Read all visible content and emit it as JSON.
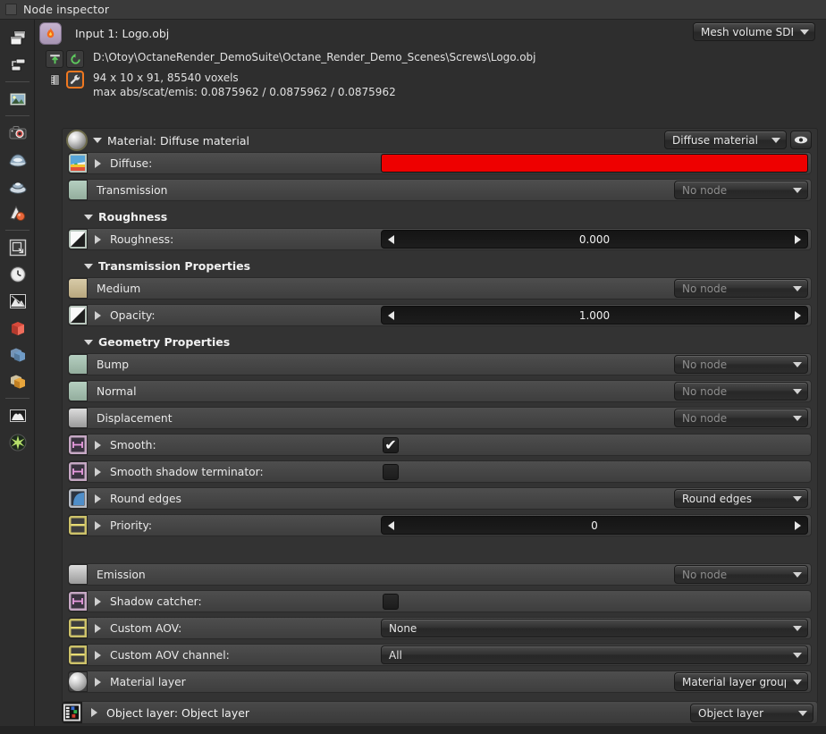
{
  "window": {
    "title": "Node inspector"
  },
  "left_toolbar": {
    "items": [
      {
        "name": "render-targets-icon",
        "label": "Render targets"
      },
      {
        "name": "node-graph-icon",
        "label": "Node graph"
      },
      {
        "sep": true
      },
      {
        "name": "image-icon",
        "label": "Image"
      },
      {
        "sep": true
      },
      {
        "name": "camera-icon",
        "label": "Camera"
      },
      {
        "name": "environment-icon",
        "label": "Environment"
      },
      {
        "name": "medium-icon",
        "label": "Medium"
      },
      {
        "name": "material-icon",
        "label": "Material"
      },
      {
        "sep": true
      },
      {
        "name": "resolution-icon",
        "label": "Resolution"
      },
      {
        "name": "clock-icon",
        "label": "Animation"
      },
      {
        "name": "render-passes-icon",
        "label": "Render passes"
      },
      {
        "name": "red-cube-icon",
        "label": "Geometry red"
      },
      {
        "name": "blue-cube-icon",
        "label": "Geometry blue"
      },
      {
        "name": "orange-cube-icon",
        "label": "Geometry orange"
      },
      {
        "sep": true
      },
      {
        "name": "histogram-icon",
        "label": "Histogram"
      },
      {
        "name": "kernel-icon",
        "label": "Kernel"
      }
    ]
  },
  "node": {
    "badge_icon": "flame-icon",
    "title": "Input 1: Logo.obj",
    "type_selector": "Mesh volume SDF",
    "file": {
      "reload_icon": "import-icon",
      "refresh_icon": "refresh-icon",
      "path": "D:\\Otoy\\OctaneRender_DemoSuite\\Octane_Render_Demo_Scenes\\Screws\\Logo.obj",
      "film_icon": "film-icon",
      "wrench_icon": "wrench-icon",
      "voxel_info": "94 x 10 x 91, 85540 voxels",
      "absorption_info": "max abs/scat/emis: 0.0875962 / 0.0875962 / 0.0875962"
    }
  },
  "material": {
    "header_label": "Material: Diffuse material",
    "header_selector": "Diffuse material",
    "eye_icon": "eye-icon",
    "rows": [
      {
        "kind": "pin",
        "name": "diffuse",
        "label": "Diffuse:",
        "pin": "image-swatch",
        "expand": true,
        "control": "color",
        "color": "#ee0000"
      },
      {
        "kind": "pin",
        "name": "transmission",
        "label": "Transmission",
        "pin": "green-swatch",
        "expand": false,
        "control": "combo",
        "value": "No node",
        "muted": true
      },
      {
        "kind": "group",
        "name": "roughness-group",
        "label": "Roughness"
      },
      {
        "kind": "pin",
        "name": "roughness",
        "label": "Roughness:",
        "pin": "gray-swatch",
        "expand": true,
        "control": "number",
        "value": "0.000"
      },
      {
        "kind": "group",
        "name": "transmission-properties-group",
        "label": "Transmission Properties"
      },
      {
        "kind": "pin",
        "name": "medium",
        "label": "Medium",
        "pin": "tan-swatch",
        "expand": false,
        "control": "combo",
        "value": "No node",
        "muted": true
      },
      {
        "kind": "pin",
        "name": "opacity",
        "label": "Opacity:",
        "pin": "gray-swatch",
        "expand": true,
        "control": "number",
        "value": "1.000"
      },
      {
        "kind": "group",
        "name": "geometry-properties-group",
        "label": "Geometry Properties"
      },
      {
        "kind": "pin",
        "name": "bump",
        "label": "Bump",
        "pin": "green-swatch",
        "expand": false,
        "control": "combo",
        "value": "No node",
        "muted": true
      },
      {
        "kind": "pin",
        "name": "normal",
        "label": "Normal",
        "pin": "green-swatch",
        "expand": false,
        "control": "combo",
        "value": "No node",
        "muted": true
      },
      {
        "kind": "pin",
        "name": "displacement",
        "label": "Displacement",
        "pin": "silver-swatch",
        "expand": false,
        "control": "combo",
        "value": "No node",
        "muted": true
      },
      {
        "kind": "pin",
        "name": "smooth",
        "label": "Smooth:",
        "pin": "bool-swatch",
        "expand": true,
        "control": "checkbox",
        "checked": true
      },
      {
        "kind": "pin",
        "name": "smooth-shadow-terminator",
        "label": "Smooth shadow terminator:",
        "pin": "bool-swatch",
        "expand": true,
        "control": "checkbox",
        "checked": false
      },
      {
        "kind": "pin",
        "name": "round-edges",
        "label": "Round edges",
        "pin": "roundedge-swatch",
        "expand": true,
        "control": "combo",
        "value": "Round edges",
        "muted": false
      },
      {
        "kind": "pin",
        "name": "priority",
        "label": "Priority:",
        "pin": "int-swatch",
        "expand": true,
        "control": "number",
        "value": "0"
      },
      {
        "kind": "spacer",
        "name": "row-spacer"
      },
      {
        "kind": "pin",
        "name": "emission",
        "label": "Emission",
        "pin": "silver-swatch",
        "expand": false,
        "control": "combo",
        "value": "No node",
        "muted": true
      },
      {
        "kind": "pin",
        "name": "shadow-catcher",
        "label": "Shadow catcher:",
        "pin": "bool-swatch",
        "expand": true,
        "control": "checkbox",
        "checked": false
      },
      {
        "kind": "pin",
        "name": "custom-aov",
        "label": "Custom AOV:",
        "pin": "int-swatch",
        "expand": true,
        "control": "widecombo",
        "value": "None"
      },
      {
        "kind": "pin",
        "name": "custom-aov-channel",
        "label": "Custom AOV channel:",
        "pin": "int-swatch",
        "expand": true,
        "control": "widecombo",
        "value": "All"
      },
      {
        "kind": "pin",
        "name": "material-layer",
        "label": "Material layer",
        "pin": "halfsphere-swatch",
        "expand": true,
        "control": "combo",
        "value": "Material layer group",
        "muted": false
      }
    ]
  },
  "object_layer": {
    "icon": "object-layer-icon",
    "label": "Object layer: Object layer",
    "selector": "Object layer"
  },
  "colors": {
    "diffuse": "#ee0000",
    "highlight": "#f07820",
    "panel_bg": "#2e2e2e",
    "matbox_bg": "#333333",
    "row_bg": "#464646"
  }
}
